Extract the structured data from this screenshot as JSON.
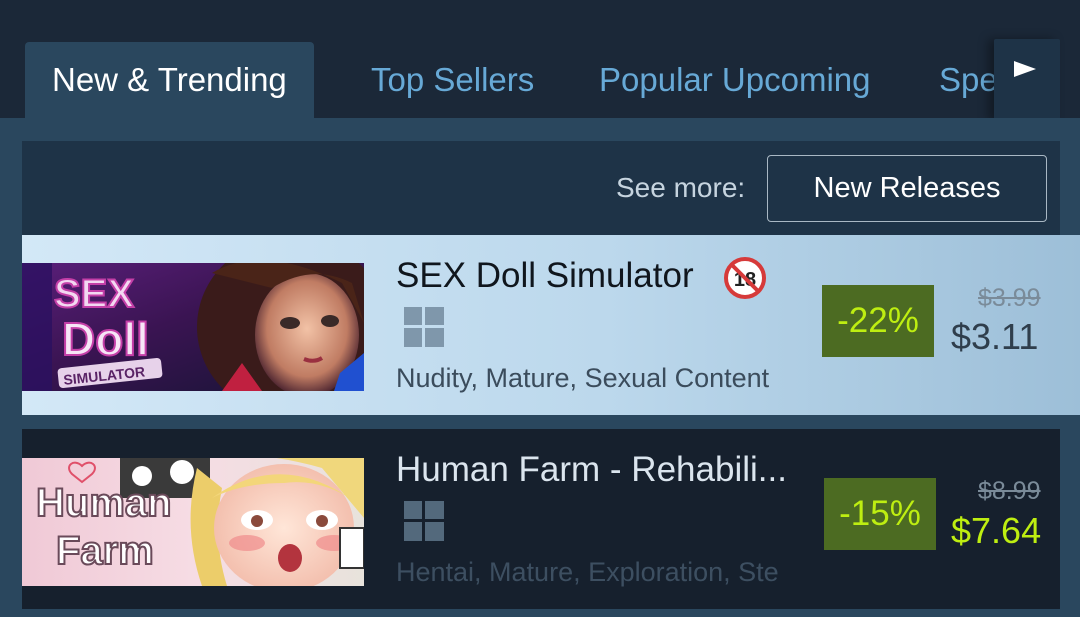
{
  "tabs": [
    {
      "label": "New & Trending",
      "active": true
    },
    {
      "label": "Top Sellers",
      "active": false
    },
    {
      "label": "Popular Upcoming",
      "active": false
    },
    {
      "label": "Spe",
      "active": false
    }
  ],
  "tab_scroll_icon": "play-right-icon",
  "see_more": {
    "label": "See more:",
    "button_label": "New Releases"
  },
  "games": [
    {
      "title": "SEX Doll Simulator",
      "age_badge": "under-18-prohibited-icon",
      "platform_icon": "windows-icon",
      "tags": "Nudity, Mature, Sexual Content",
      "discount": "-22%",
      "original_price": "$3.99",
      "final_price": "$3.11",
      "capsule_text": [
        "SEX",
        "Doll",
        "SIMULATOR"
      ]
    },
    {
      "title": "Human Farm - Rehabili...",
      "platform_icon": "windows-icon",
      "tags": "Hentai, Mature, Exploration, Ste",
      "discount": "-15%",
      "original_price": "$8.99",
      "final_price": "$7.64",
      "capsule_text": [
        "Human",
        "Farm"
      ]
    }
  ],
  "colors": {
    "background": "#1b2838",
    "panel": "#2a475e",
    "tab_inactive": "#67a9d6",
    "discount_bg": "#4c6b22",
    "discount_text": "#beee11"
  }
}
